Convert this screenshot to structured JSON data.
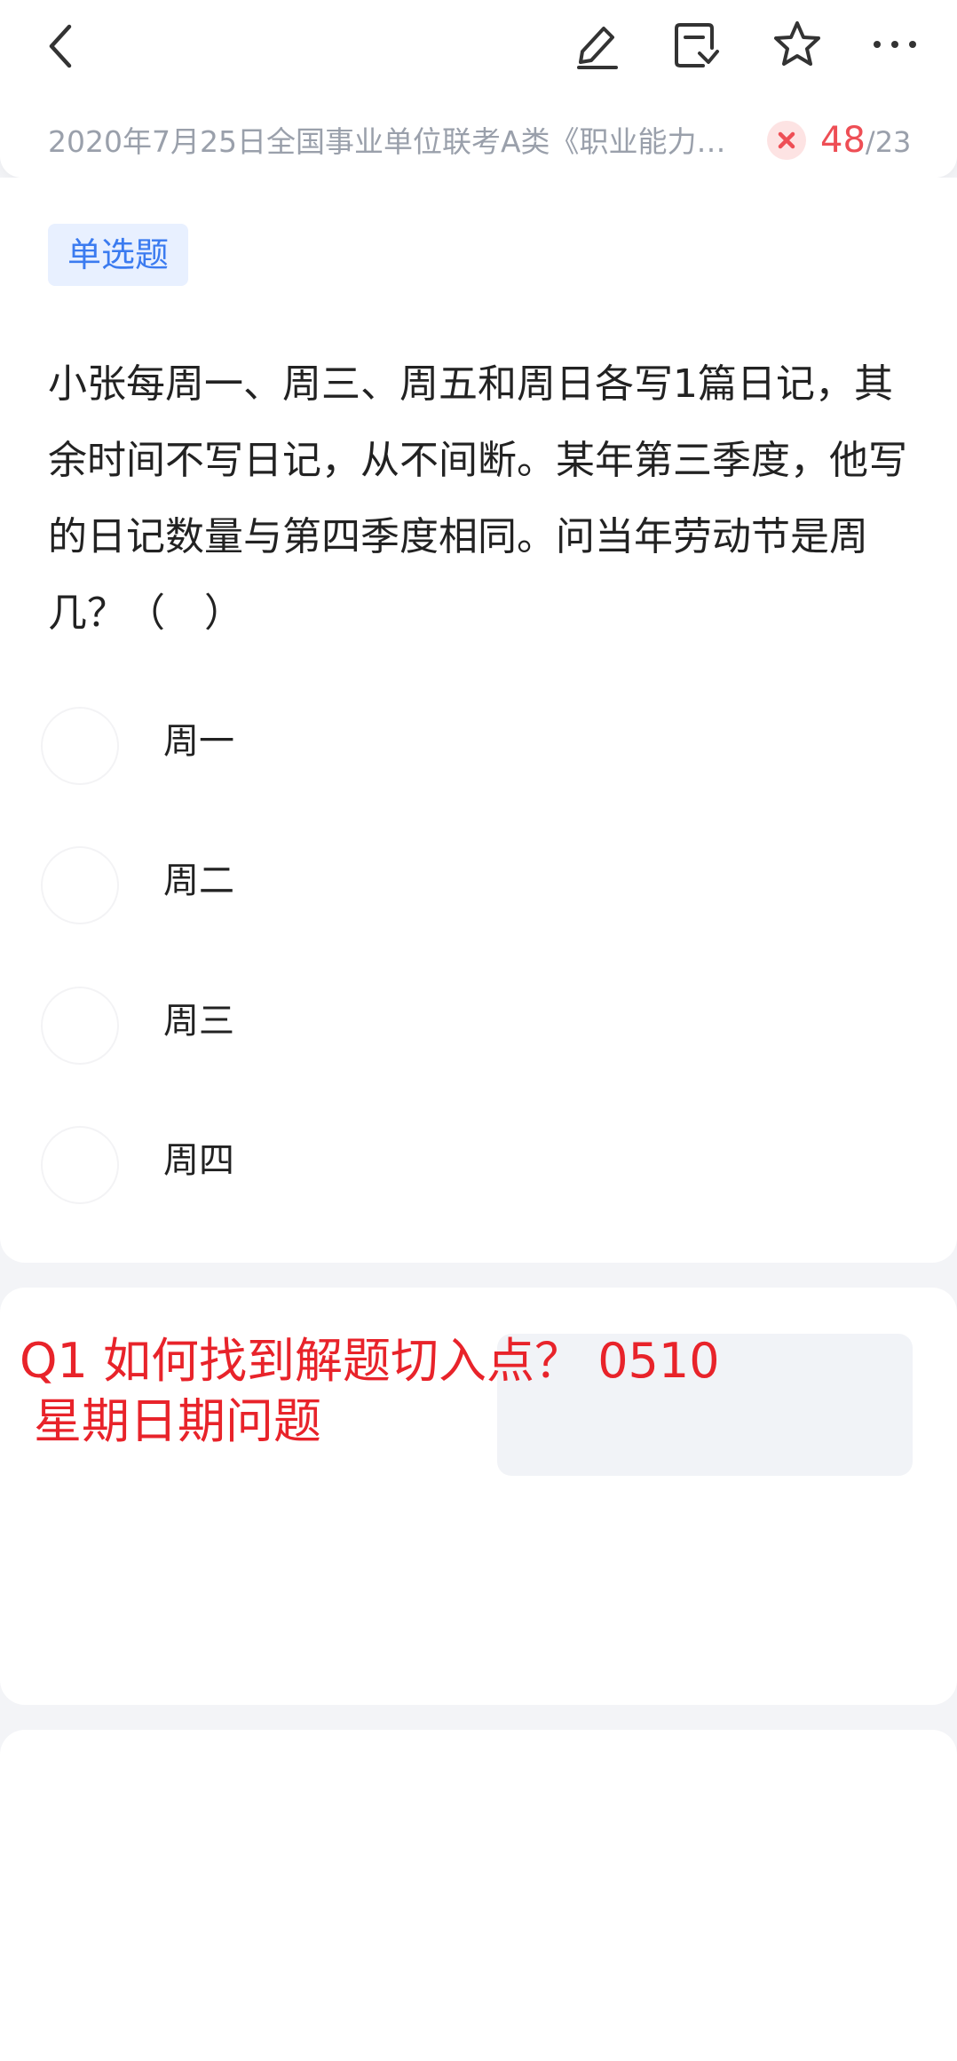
{
  "header": {
    "subtitle": "2020年7月25日全国事业单位联考A类《职业能力…",
    "current": "48",
    "total": "/23",
    "icons": [
      "back-icon",
      "edit-icon",
      "note-icon",
      "star-icon",
      "more-icon"
    ],
    "accent_color": "#3b7bf0",
    "error_color": "#ee4e55"
  },
  "question": {
    "type_label": "单选题",
    "stem": "小张每周一、周三、周五和周日各写1篇日记，其余时间不写日记，从不间断。某年第三季度，他写的日记数量与第四季度相同。问当年劳动节是周几？（　）",
    "options": [
      {
        "label": "周一"
      },
      {
        "label": "周二"
      },
      {
        "label": "周三"
      },
      {
        "label": "周四"
      }
    ]
  },
  "annotation": {
    "line1": "Q1 如何找到解题切入点？  0510",
    "line2": "星期日期问题"
  }
}
